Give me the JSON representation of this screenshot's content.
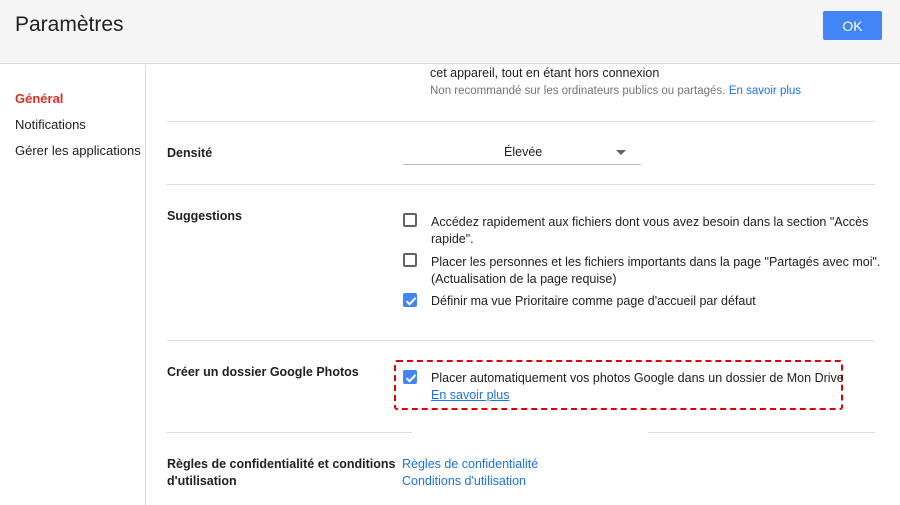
{
  "header": {
    "title": "Paramètres",
    "ok_label": "OK"
  },
  "sidebar": {
    "items": [
      {
        "label": "Général",
        "active": true
      },
      {
        "label": "Notifications",
        "active": false
      },
      {
        "label": "Gérer les applications",
        "active": false
      }
    ]
  },
  "offline": {
    "line1": "cet appareil, tout en étant hors connexion",
    "note": "Non recommandé sur les ordinateurs publics ou partagés.",
    "learn_more": "En savoir plus"
  },
  "density": {
    "label": "Densité",
    "selected": "Élevée"
  },
  "suggestions": {
    "label": "Suggestions",
    "options": [
      {
        "line1": "Accédez rapidement aux fichiers dont vous avez besoin dans la section \"Accès",
        "line2": "rapide\".",
        "checked": false
      },
      {
        "line1": "Placer les personnes et les fichiers importants dans la page \"Partagés avec moi\".",
        "line2": "(Actualisation de la page requise)",
        "checked": false
      },
      {
        "line1": "Définir ma vue Prioritaire comme page d'accueil par défaut",
        "line2": "",
        "checked": true
      }
    ]
  },
  "photos": {
    "label": "Créer un dossier Google Photos",
    "option": "Placer automatiquement vos photos Google dans un dossier de Mon Drive",
    "learn_more": "En savoir plus",
    "checked": true
  },
  "privacy": {
    "label_line1": "Règles de confidentialité et conditions",
    "label_line2": "d'utilisation",
    "link1": "Règles de confidentialité",
    "link2": "Conditions d'utilisation"
  },
  "colors": {
    "accent": "#4285f4",
    "active_nav": "#d93025",
    "link": "#1a73e8",
    "highlight": "#e00000"
  }
}
